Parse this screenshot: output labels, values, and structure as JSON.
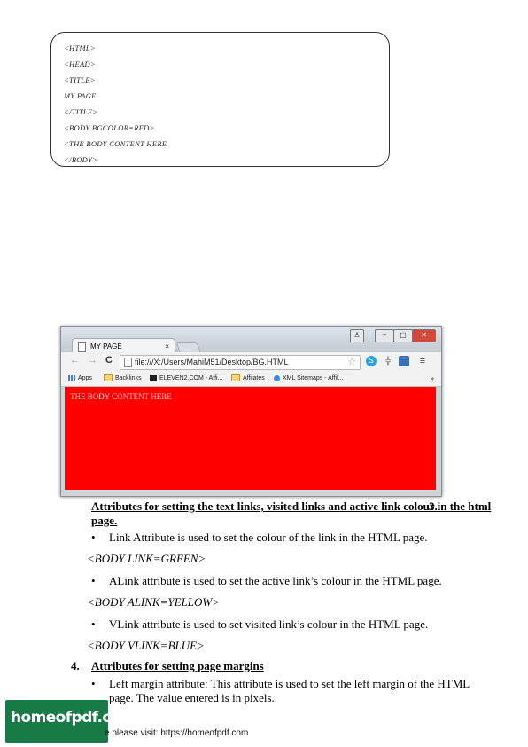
{
  "code_box": {
    "lines": [
      "<HTML>",
      "<HEAD>",
      "<TITLE>",
      "MY  PAGE",
      "</TITLE>",
      "<BODY  BGCOLOR=RED>",
      "<THE  BODY  CONTENT  HERE",
      "</BODY>"
    ]
  },
  "browser": {
    "tab_title": "MY PAGE",
    "tab_close": "×",
    "url": "file:///X:/Users/MahiM51/Desktop/BG.HTML",
    "bookmarks": [
      "Apps",
      "Backlinks",
      "ELEVEN2.COM - Affi...",
      "Affilates",
      "XML Sitemaps - Affil..."
    ],
    "bookmarks_more": "»",
    "body_text": "THE BODY CONTENT HERE",
    "page_bg": "#ff0000"
  },
  "section3": {
    "heading": "Attributes for setting the text links, visited links and active link colour in the html page.",
    "number": "3.",
    "items": [
      {
        "text": "Link Attribute is used to set the colour of the link in the HTML page.",
        "example": "<BODY LINK=GREEN>"
      },
      {
        "text": "ALink attribute is used to set the active link’s colour in the HTML page.",
        "example": "<BODY ALINK=YELLOW>"
      },
      {
        "text": "VLink attribute is used to set visited link’s colour in the HTML page.",
        "example": "<BODY VLINK=BLUE>"
      }
    ]
  },
  "section4": {
    "number": "4.",
    "heading": "Attributes for setting page margins",
    "item": "Left margin attribute: This attribute is used to set the left margin of the HTML page. The value entered is in pixels."
  },
  "footer": {
    "logo": "homeofpdf.com",
    "text": "e please visit: https://homeofpdf.com"
  },
  "colors": {
    "logo_bg": "#177a47",
    "browser_page": "#ff0000"
  }
}
